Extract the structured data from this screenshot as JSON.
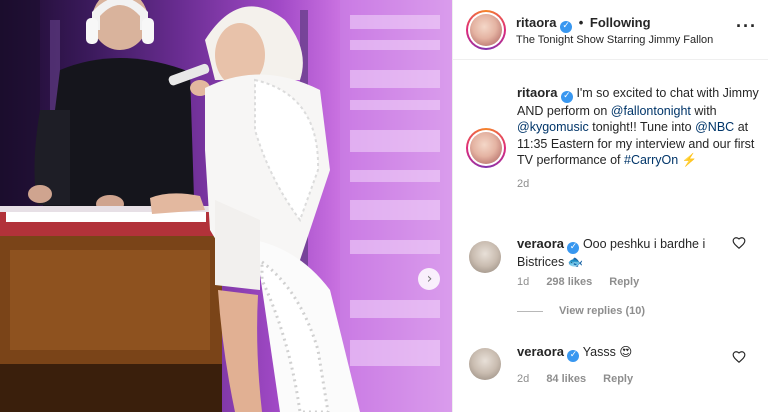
{
  "post": {
    "author": "ritaora",
    "follow_status": "Following",
    "location": "The Tonight Show Starring Jimmy Fallon",
    "more_icon": "more-options-icon",
    "verified_icon": "verified-badge-icon",
    "caption": {
      "author": "ritaora",
      "text_1": "I'm so excited to chat with Jimmy AND perform on",
      "mention_1": "@fallontonight",
      "text_2": "with",
      "mention_2": "@kygomusic",
      "text_3": "tonight!! Tune into",
      "mention_3": "@NBC",
      "text_4": "at 11:35 Eastern for my interview and our first TV performance of",
      "hashtag": "#CarryOn",
      "emoji": "⚡️",
      "time": "2d"
    }
  },
  "comments": [
    {
      "author": "veraora",
      "text": "Ooo peshku i bardhe i Bistrices 🐟",
      "time": "1d",
      "likes": "298 likes",
      "reply_label": "Reply"
    },
    {
      "author": "veraora",
      "text": "Yasss 😍",
      "time": "2d",
      "likes": "84 likes",
      "reply_label": "Reply"
    }
  ],
  "view_replies_label": "View replies (10)",
  "colors": {
    "link": "#003569",
    "verified": "#3897f0",
    "muted": "#8e8e8e",
    "text": "#262626"
  }
}
